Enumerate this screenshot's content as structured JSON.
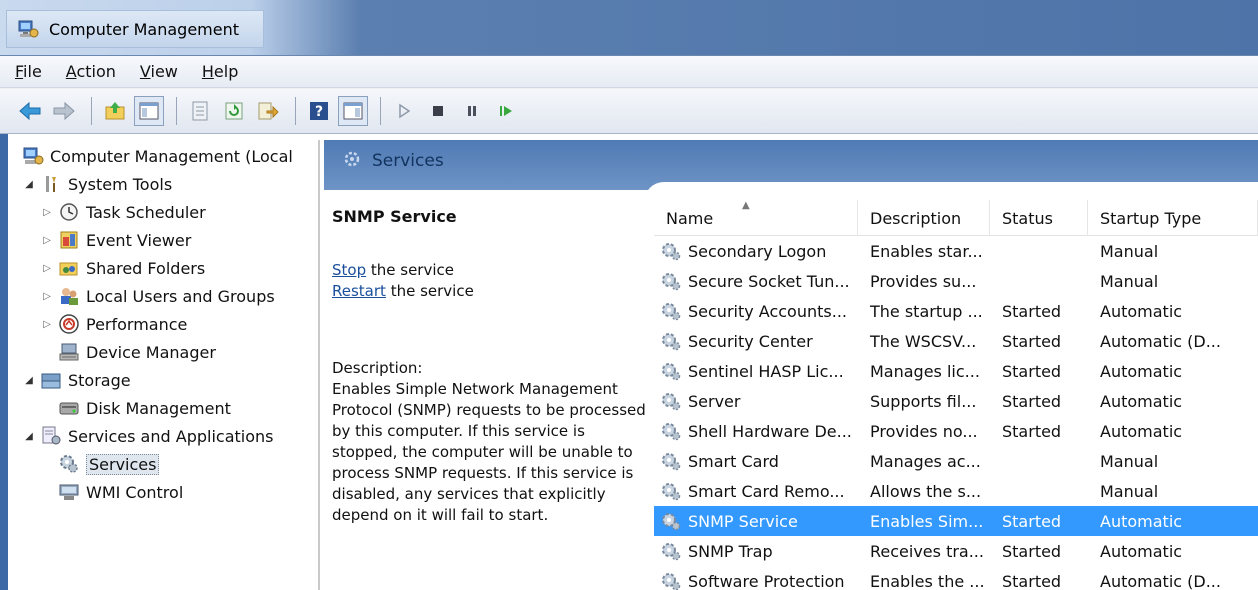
{
  "window": {
    "title": "Computer Management"
  },
  "menu": [
    {
      "label": "File",
      "ul": "F",
      "rest": "ile"
    },
    {
      "label": "Action",
      "ul": "A",
      "rest": "ction"
    },
    {
      "label": "View",
      "ul": "V",
      "rest": "iew"
    },
    {
      "label": "Help",
      "ul": "H",
      "rest": "elp"
    }
  ],
  "toolbar": [
    "back-arrow-icon",
    "forward-arrow-icon",
    "up-folder-icon",
    "show-hide-console-tree-icon",
    "properties-icon",
    "refresh-icon",
    "export-list-icon",
    "help-icon",
    "show-hide-action-pane-icon",
    "play-icon",
    "stop-icon",
    "pause-icon",
    "resume-icon"
  ],
  "tree": [
    {
      "label": "Computer Management (Local",
      "icon": "computer-management-icon"
    },
    {
      "label": "System Tools",
      "icon": "system-tools-icon"
    },
    {
      "label": "Task Scheduler",
      "icon": "task-scheduler-icon"
    },
    {
      "label": "Event Viewer",
      "icon": "event-viewer-icon"
    },
    {
      "label": "Shared Folders",
      "icon": "shared-folders-icon"
    },
    {
      "label": "Local Users and Groups",
      "icon": "users-icon"
    },
    {
      "label": "Performance",
      "icon": "performance-icon"
    },
    {
      "label": "Device Manager",
      "icon": "device-manager-icon"
    },
    {
      "label": "Storage",
      "icon": "storage-icon"
    },
    {
      "label": "Disk Management",
      "icon": "disk-icon"
    },
    {
      "label": "Services and Applications",
      "icon": "services-apps-icon"
    },
    {
      "label": "Services",
      "icon": "services-icon"
    },
    {
      "label": "WMI Control",
      "icon": "wmi-icon"
    }
  ],
  "panel": {
    "header": "Services",
    "selected_service": "SNMP Service",
    "stop_link": "Stop",
    "stop_rest": " the service",
    "restart_link": "Restart",
    "restart_rest": " the service",
    "description_label": "Description:",
    "description": "Enables Simple Network Management Protocol (SNMP) requests to be processed by this computer. If this service is stopped, the computer will be unable to process SNMP requests. If this service is disabled, any services that explicitly depend on it will fail to start."
  },
  "table": {
    "columns": [
      "Name",
      "Description",
      "Status",
      "Startup Type"
    ],
    "rows": [
      {
        "name": "Secondary Logon",
        "desc": "Enables star...",
        "status": "",
        "startup": "Manual"
      },
      {
        "name": "Secure Socket Tun...",
        "desc": "Provides su...",
        "status": "",
        "startup": "Manual"
      },
      {
        "name": "Security Accounts...",
        "desc": "The startup ...",
        "status": "Started",
        "startup": "Automatic"
      },
      {
        "name": "Security Center",
        "desc": "The WSCSV...",
        "status": "Started",
        "startup": "Automatic (D..."
      },
      {
        "name": "Sentinel HASP Lic...",
        "desc": "Manages lic...",
        "status": "Started",
        "startup": "Automatic"
      },
      {
        "name": "Server",
        "desc": "Supports fil...",
        "status": "Started",
        "startup": "Automatic"
      },
      {
        "name": "Shell Hardware De...",
        "desc": "Provides no...",
        "status": "Started",
        "startup": "Automatic"
      },
      {
        "name": "Smart Card",
        "desc": "Manages ac...",
        "status": "",
        "startup": "Manual"
      },
      {
        "name": "Smart Card Remo...",
        "desc": "Allows the s...",
        "status": "",
        "startup": "Manual"
      },
      {
        "name": "SNMP Service",
        "desc": "Enables Sim...",
        "status": "Started",
        "startup": "Automatic",
        "selected": true
      },
      {
        "name": "SNMP Trap",
        "desc": "Receives tra...",
        "status": "Started",
        "startup": "Automatic"
      },
      {
        "name": "Software Protection",
        "desc": "Enables the ...",
        "status": "Started",
        "startup": "Automatic (D..."
      }
    ]
  },
  "colors": {
    "selection": "#3399ff",
    "link": "#1a4f9c",
    "header": "#4f7ab4"
  }
}
